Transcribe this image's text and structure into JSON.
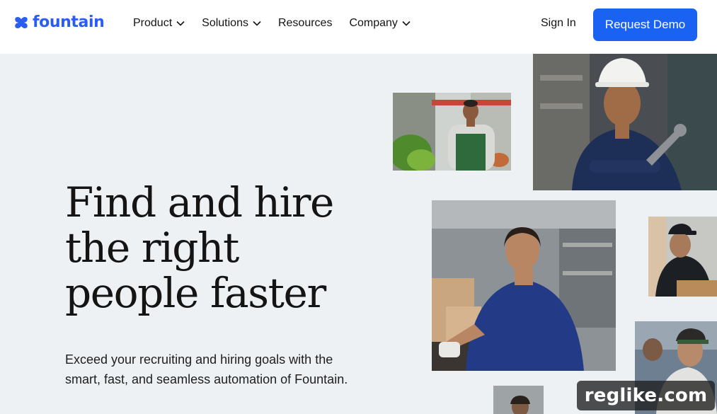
{
  "header": {
    "brand": "fountain",
    "nav_items": [
      {
        "label": "Product",
        "has_dropdown": true
      },
      {
        "label": "Solutions",
        "has_dropdown": true
      },
      {
        "label": "Resources",
        "has_dropdown": false
      },
      {
        "label": "Company",
        "has_dropdown": true
      }
    ],
    "sign_in": "Sign In",
    "cta": "Request Demo"
  },
  "hero": {
    "title_lines": [
      "Find and hire",
      "the right",
      "people faster"
    ],
    "subtitle": "Exceed your recruiting and hiring goals with the smart, fast, and seamless automation of Fountain."
  },
  "photos": [
    {
      "subject": "grocery-worker"
    },
    {
      "subject": "construction-worker"
    },
    {
      "subject": "warehouse-worker"
    },
    {
      "subject": "delivery-worker"
    },
    {
      "subject": "line-worker"
    },
    {
      "subject": "worker"
    }
  ],
  "watermark": "reglike.com",
  "colors": {
    "brand": "#2a5ef0",
    "cta": "#1a62f2",
    "background": "#eef1f4",
    "text": "#141414"
  }
}
